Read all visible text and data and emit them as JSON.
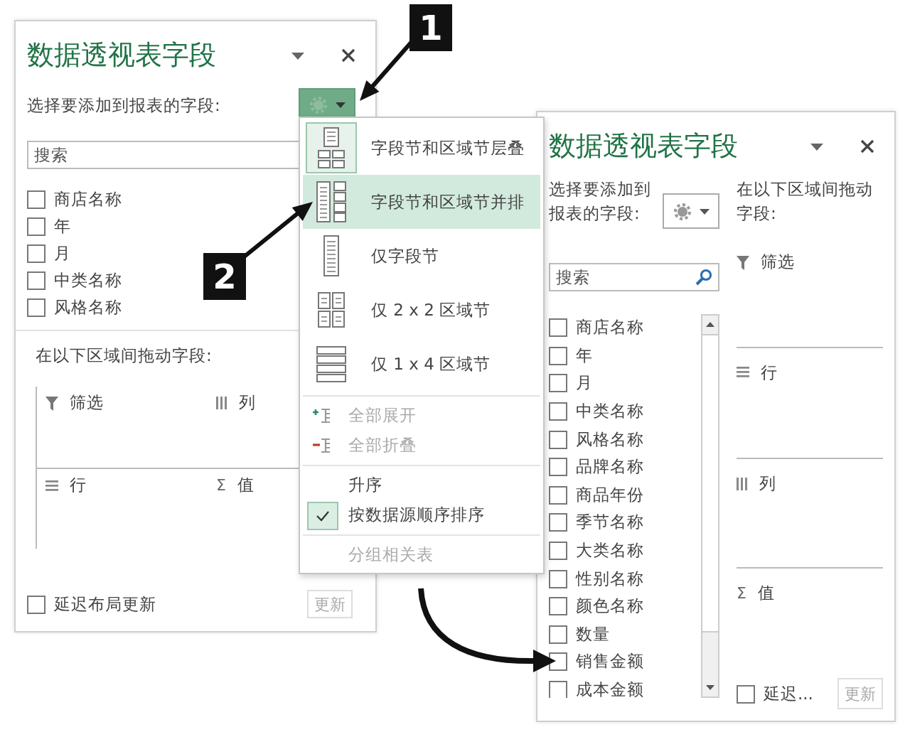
{
  "left_pane": {
    "title": "数据透视表字段",
    "field_prompt": "选择要添加到报表的字段:",
    "gear_button": {
      "active": true
    },
    "search": {
      "placeholder": "搜索"
    },
    "fields": [
      {
        "label": "商店名称",
        "checked": false
      },
      {
        "label": "年",
        "checked": false
      },
      {
        "label": "月",
        "checked": false
      },
      {
        "label": "中类名称",
        "checked": false
      },
      {
        "label": "风格名称",
        "checked": false
      }
    ],
    "areas_prompt": "在以下区域间拖动字段:",
    "areas": [
      {
        "kind": "filter",
        "label": "筛选"
      },
      {
        "kind": "columns",
        "label": "列"
      },
      {
        "kind": "rows",
        "label": "行"
      },
      {
        "kind": "values",
        "label": "值",
        "symbol": "Σ"
      }
    ],
    "defer": {
      "label": "延迟布局更新",
      "checked": false
    },
    "update_button": "更新"
  },
  "layout_menu": {
    "sections": [
      [
        {
          "kind": "layout",
          "label": "字段节和区域节层叠",
          "selected": true,
          "highlighted": false
        },
        {
          "kind": "layout",
          "label": "字段节和区域节并排",
          "selected": false,
          "highlighted": true
        },
        {
          "kind": "layout",
          "label": "仅字段节",
          "selected": false,
          "highlighted": false
        },
        {
          "kind": "layout",
          "label": "仅 2 x 2 区域节",
          "selected": false,
          "highlighted": false
        },
        {
          "kind": "layout",
          "label": "仅 1 x 4 区域节",
          "selected": false,
          "highlighted": false
        }
      ],
      [
        {
          "kind": "expand",
          "label": "全部展开",
          "disabled": true
        },
        {
          "kind": "collapse",
          "label": "全部折叠",
          "disabled": true
        }
      ],
      [
        {
          "kind": "option",
          "label": "升序",
          "checked": false,
          "disabled": false
        },
        {
          "kind": "option",
          "label": "按数据源顺序排序",
          "checked": true,
          "disabled": false
        }
      ],
      [
        {
          "kind": "option",
          "label": "分组相关表",
          "checked": false,
          "disabled": true
        }
      ]
    ]
  },
  "right_pane": {
    "title": "数据透视表字段",
    "field_prompt": "选择要添加到报表的字段:",
    "gear_button": {
      "active": false
    },
    "search": {
      "placeholder": "搜索"
    },
    "fields": [
      {
        "label": "商店名称",
        "checked": false
      },
      {
        "label": "年",
        "checked": false
      },
      {
        "label": "月",
        "checked": false
      },
      {
        "label": "中类名称",
        "checked": false
      },
      {
        "label": "风格名称",
        "checked": false
      },
      {
        "label": "品牌名称",
        "checked": false
      },
      {
        "label": "商品年份",
        "checked": false
      },
      {
        "label": "季节名称",
        "checked": false
      },
      {
        "label": "大类名称",
        "checked": false
      },
      {
        "label": "性别名称",
        "checked": false
      },
      {
        "label": "颜色名称",
        "checked": false
      },
      {
        "label": "数量",
        "checked": false
      },
      {
        "label": "销售金额",
        "checked": false
      },
      {
        "label": "成本金额",
        "checked": false
      }
    ],
    "areas_prompt": "在以下区域间拖动字段:",
    "areas": [
      {
        "kind": "filter",
        "label": "筛选"
      },
      {
        "kind": "rows",
        "label": "行"
      },
      {
        "kind": "columns",
        "label": "列"
      },
      {
        "kind": "values",
        "label": "值",
        "symbol": "Σ"
      }
    ],
    "defer": {
      "label": "延迟...",
      "checked": false
    },
    "update_button": "更新"
  },
  "callouts": [
    {
      "label": "1"
    },
    {
      "label": "2"
    }
  ]
}
